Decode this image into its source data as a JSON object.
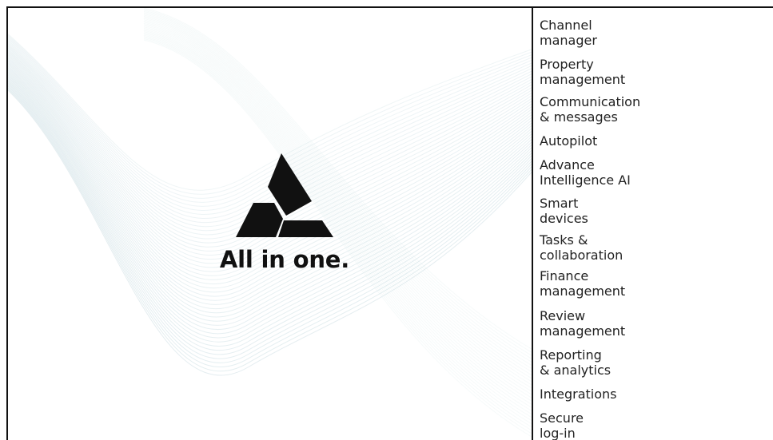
{
  "hero": {
    "tagline": "All in one."
  },
  "features": [
    {
      "label": "Channel\nmanager"
    },
    {
      "label": "Property\nmanagement"
    },
    {
      "label": "Communication\n& messages"
    },
    {
      "label": "Autopilot"
    },
    {
      "label": "Advance\nIntelligence AI"
    },
    {
      "label": "Smart\ndevices"
    },
    {
      "label": "Tasks &\ncollaboration"
    },
    {
      "label": "Finance\nmanagement"
    },
    {
      "label": "Review\nmanagement"
    },
    {
      "label": "Reporting\n& analytics"
    },
    {
      "label": "Integrations"
    },
    {
      "label": "Secure\nlog-in"
    }
  ],
  "colors": {
    "text": "#111111",
    "waves": "#d8e6ea",
    "divider": "#111111"
  },
  "icons": {
    "brand_logo": "tri-blade-logo-icon"
  }
}
